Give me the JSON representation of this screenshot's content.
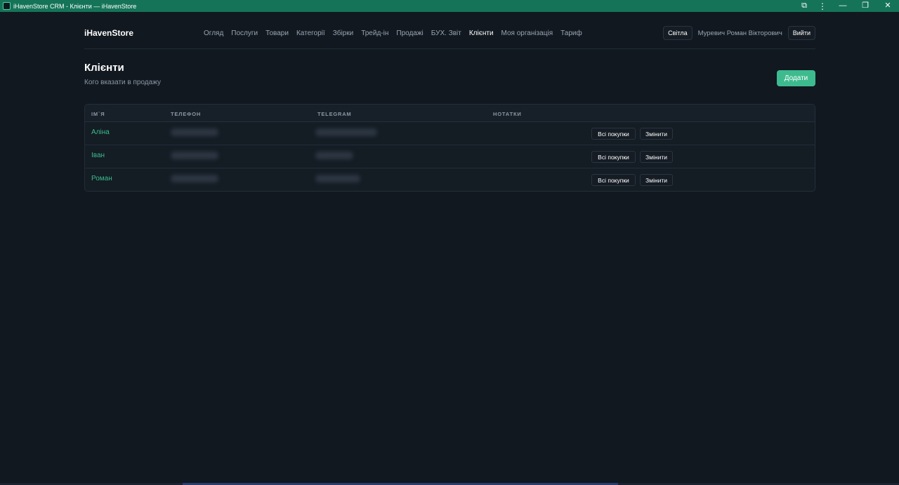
{
  "window": {
    "title": "iHavenStore CRM - Клієнти — iHavenStore",
    "controls": {
      "minimize": "—",
      "maximize": "❐",
      "close": "✕",
      "extensions": "⧉",
      "menu": "⋮"
    }
  },
  "header": {
    "brand": "iHavenStore",
    "nav": [
      {
        "label": "Огляд",
        "active": false
      },
      {
        "label": "Послуги",
        "active": false
      },
      {
        "label": "Товари",
        "active": false
      },
      {
        "label": "Категорії",
        "active": false
      },
      {
        "label": "Збірки",
        "active": false
      },
      {
        "label": "Трейд-ін",
        "active": false
      },
      {
        "label": "Продажі",
        "active": false
      },
      {
        "label": "БУХ. Звіт",
        "active": false
      },
      {
        "label": "Клієнти",
        "active": true
      },
      {
        "label": "Моя організація",
        "active": false
      },
      {
        "label": "Тариф",
        "active": false
      }
    ],
    "theme_button": "Світла",
    "user_name": "Муревич Роман Вікторович",
    "logout_button": "Вийти"
  },
  "page": {
    "title": "Клієнти",
    "subtitle": "Кого вказати в продажу",
    "add_button": "Додати"
  },
  "table": {
    "headers": [
      "ІМ`Я",
      "ТЕЛЕФОН",
      "TELEGRAM",
      "НОТАТКИ"
    ],
    "rows": [
      {
        "name": "Аліна",
        "phone": "",
        "telegram": "",
        "notes": "",
        "purchases_button": "Всі покупки",
        "edit_button": "Змінити"
      },
      {
        "name": "Іван",
        "phone": "",
        "telegram": "",
        "notes": "",
        "purchases_button": "Всі покупки",
        "edit_button": "Змінити"
      },
      {
        "name": "Роман",
        "phone": "",
        "telegram": "",
        "notes": "",
        "purchases_button": "Всі покупки",
        "edit_button": "Змінити"
      }
    ]
  },
  "colors": {
    "accent": "#3dbb8e",
    "background": "#111820",
    "titlebar": "#157458",
    "card": "#141c24"
  }
}
